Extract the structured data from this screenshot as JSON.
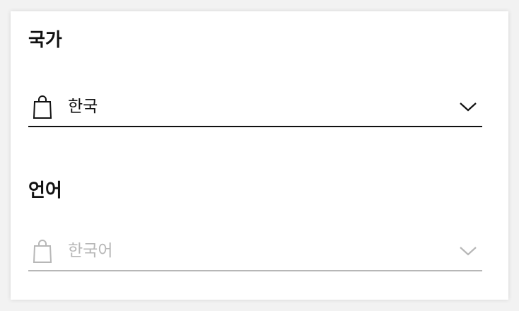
{
  "country": {
    "label": "국가",
    "selected": "한국",
    "icon": "shopping-bag-icon",
    "state": "enabled"
  },
  "language": {
    "label": "언어",
    "selected": "한국어",
    "icon": "shopping-bag-icon",
    "state": "disabled"
  },
  "colors": {
    "active": "#111111",
    "disabled": "#b7b7b7"
  }
}
